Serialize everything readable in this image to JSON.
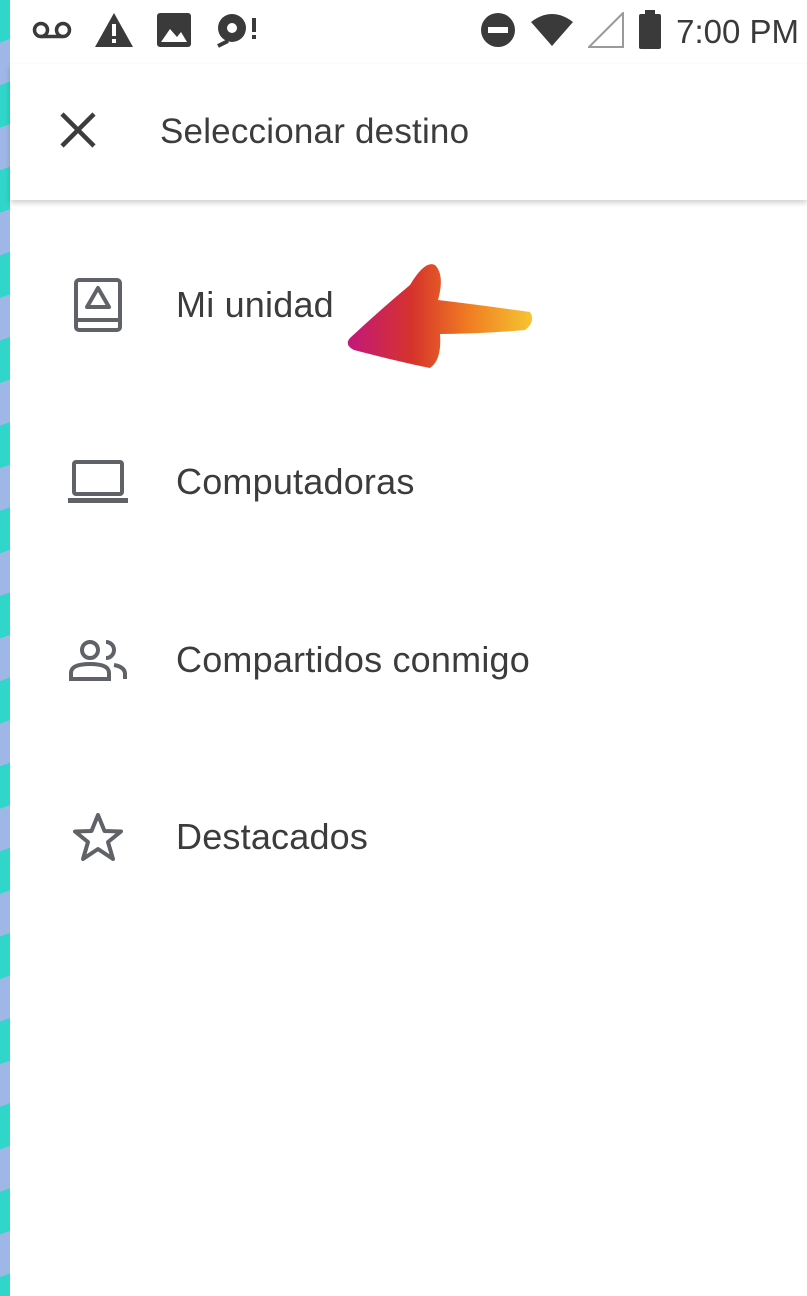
{
  "status_bar": {
    "time": "7:00 PM",
    "left_icons": [
      "voicemail-icon",
      "warning-icon",
      "image-icon",
      "sync-icon"
    ],
    "right_icons": [
      "do-not-disturb-icon",
      "wifi-icon",
      "signal-icon",
      "battery-icon"
    ]
  },
  "toolbar": {
    "title": "Seleccionar destino",
    "close_icon": "close-icon"
  },
  "destinations": [
    {
      "label": "Mi unidad",
      "icon": "drive-icon"
    },
    {
      "label": "Computadoras",
      "icon": "laptop-icon"
    },
    {
      "label": "Compartidos conmigo",
      "icon": "people-icon"
    },
    {
      "label": "Destacados",
      "icon": "star-icon"
    }
  ],
  "colors": {
    "icon": "#5f6368",
    "text": "#3c3c3c",
    "background": "#ffffff"
  }
}
